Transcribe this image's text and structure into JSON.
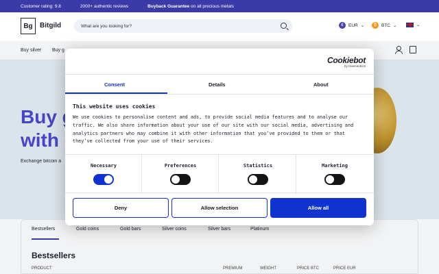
{
  "topbar": {
    "rating": "Customer rating: 9.8",
    "reviews": "2000+ authentic reviews",
    "guarantee_bold": "Buyback Guarantee",
    "guarantee_rest": " on all precious metals"
  },
  "header": {
    "logo_mark": "Bg",
    "logo_text": "Bitgild",
    "search_placeholder": "What are you looking for?",
    "currency1": "EUR",
    "currency1_symbol": "€",
    "currency2": "BTC",
    "currency2_symbol": "₿",
    "chevron": "⌄"
  },
  "nav": {
    "item1": "Buy silver",
    "item2": "Buy g"
  },
  "hero": {
    "line1": "Buy g",
    "line2": "with c",
    "subtitle": "Exchange bitcoin a"
  },
  "panel": {
    "tabs": [
      "Bestsellers",
      "Gold coins",
      "Gold bars",
      "Silver coins",
      "Silver bars",
      "Platinum"
    ],
    "heading": "Bestsellers",
    "columns": [
      "PRODUCT",
      "PREMIUM",
      "WEIGHT",
      "PRICE BTC",
      "PRICE EUR"
    ]
  },
  "cookie": {
    "brand": "Cookiebot",
    "brand_by": "by Usercentrics",
    "tabs": [
      "Consent",
      "Details",
      "About"
    ],
    "title": "This website uses cookies",
    "body": "We use cookies to personalise content and ads, to provide social media features and to analyse our traffic. We also share information about your use of our site with our social media, advertising and analytics partners who may combine it with other information that you’ve provided to them or that they’ve collected from your use of their services.",
    "categories": [
      {
        "label": "Necessary",
        "enabled": true
      },
      {
        "label": "Preferences",
        "enabled": false
      },
      {
        "label": "Statistics",
        "enabled": false
      },
      {
        "label": "Marketing",
        "enabled": false
      }
    ],
    "deny": "Deny",
    "allow_selection": "Allow selection",
    "allow_all": "Allow all"
  },
  "colors": {
    "accent": "#1032cf",
    "brand": "#3a3aa8",
    "hero_text": "#4a46d4"
  }
}
